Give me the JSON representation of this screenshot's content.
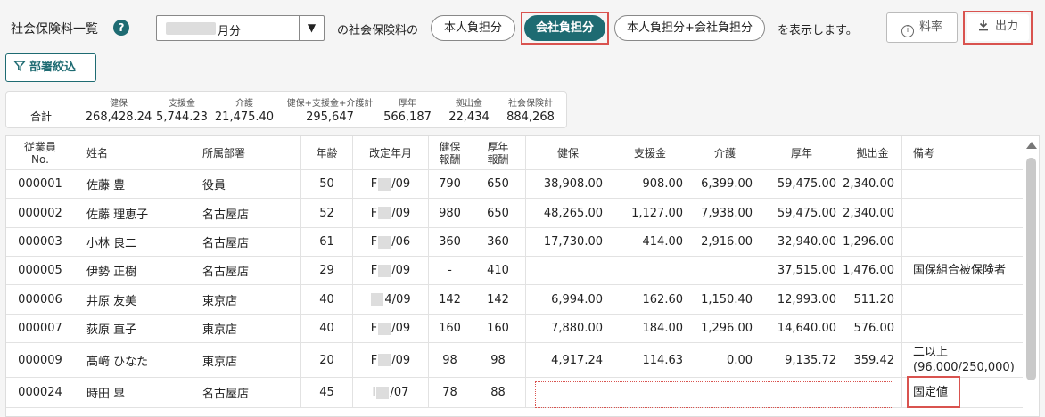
{
  "header": {
    "title": "社会保険料一覧",
    "help_icon": "question-circle-icon",
    "month_value": "月分",
    "social_label": "の社会保険料の",
    "display_label": "を表示します。",
    "toggle_employee": "本人負担分",
    "toggle_company": "会社負担分",
    "toggle_both": "本人負担分+会社負担分",
    "rate_button": "料率",
    "export_button": "出力",
    "accent": "#1e6b72",
    "highlight": "#d9534f"
  },
  "filter": {
    "label": "部署絞込"
  },
  "totals": {
    "label": "合計",
    "columns": [
      {
        "h": "健保",
        "v": "268,428.24"
      },
      {
        "h": "支援金",
        "v": "5,744.23"
      },
      {
        "h": "介護",
        "v": "21,475.40"
      },
      {
        "h": "健保+支援金+介護計",
        "v": "295,647"
      },
      {
        "h": "厚年",
        "v": "566,187"
      },
      {
        "h": "拠出金",
        "v": "22,434"
      },
      {
        "h": "社会保険計",
        "v": "884,268"
      }
    ]
  },
  "table": {
    "headers": {
      "no1": "従業員",
      "no2": "No.",
      "name": "姓名",
      "dept": "所属部署",
      "age": "年齢",
      "revised": "改定年月",
      "kenpo1": "健保",
      "kenpo2": "報酬",
      "kounen1": "厚年",
      "kounen2": "報酬",
      "kenpo_amt": "健保",
      "shien": "支援金",
      "kaigo": "介護",
      "kounen_amt": "厚年",
      "kyoshutsu": "拠出金",
      "note": "備考"
    },
    "rows": [
      {
        "no": "000001",
        "name": "佐藤 豊",
        "dept": "役員",
        "age": "50",
        "rp": "F",
        "rs": "/09",
        "kr": "790",
        "kor": "650",
        "ka": "38,908.00",
        "sh": "908.00",
        "kg": "6,399.00",
        "koa": "59,475.00",
        "ky": "2,340.00",
        "note1": "",
        "note2": ""
      },
      {
        "no": "000002",
        "name": "佐藤 理恵子",
        "dept": "名古屋店",
        "age": "52",
        "rp": "F",
        "rs": "/09",
        "kr": "980",
        "kor": "650",
        "ka": "48,265.00",
        "sh": "1,127.00",
        "kg": "7,938.00",
        "koa": "59,475.00",
        "ky": "2,340.00",
        "note1": "",
        "note2": ""
      },
      {
        "no": "000003",
        "name": "小林 良二",
        "dept": "名古屋店",
        "age": "61",
        "rp": "F",
        "rs": "/06",
        "kr": "360",
        "kor": "360",
        "ka": "17,730.00",
        "sh": "414.00",
        "kg": "2,916.00",
        "koa": "32,940.00",
        "ky": "1,296.00",
        "note1": "",
        "note2": ""
      },
      {
        "no": "000005",
        "name": "伊勢 正樹",
        "dept": "名古屋店",
        "age": "29",
        "rp": "F",
        "rs": "/09",
        "kr": "-",
        "kor": "410",
        "ka": "",
        "sh": "",
        "kg": "",
        "koa": "37,515.00",
        "ky": "1,476.00",
        "note1": "国保組合被保険者",
        "note2": ""
      },
      {
        "no": "000006",
        "name": "井原 友美",
        "dept": "東京店",
        "age": "40",
        "rp": "",
        "rs": "4/09",
        "kr": "142",
        "kor": "142",
        "ka": "6,994.00",
        "sh": "162.60",
        "kg": "1,150.40",
        "koa": "12,993.00",
        "ky": "511.20",
        "note1": "",
        "note2": ""
      },
      {
        "no": "000007",
        "name": "荻原 直子",
        "dept": "東京店",
        "age": "40",
        "rp": "F",
        "rs": "/09",
        "kr": "160",
        "kor": "160",
        "ka": "7,880.00",
        "sh": "184.00",
        "kg": "1,296.00",
        "koa": "14,640.00",
        "ky": "576.00",
        "note1": "",
        "note2": ""
      },
      {
        "no": "000009",
        "name": "髙﨑 ひなた",
        "dept": "東京店",
        "age": "20",
        "rp": "F",
        "rs": "/09",
        "kr": "98",
        "kor": "98",
        "ka": "4,917.24",
        "sh": "114.63",
        "kg": "0.00",
        "koa": "9,135.72",
        "ky": "359.42",
        "note1": "二以上",
        "note2": "(96,000/250,000)"
      },
      {
        "no": "000024",
        "name": "時田 皐",
        "dept": "名古屋店",
        "age": "45",
        "rp": "I",
        "rs": "/07",
        "kr": "78",
        "kor": "88",
        "ka": "",
        "sh": "",
        "kg": "",
        "koa": "",
        "ky": "",
        "note1": "固定値",
        "note2": ""
      }
    ]
  }
}
